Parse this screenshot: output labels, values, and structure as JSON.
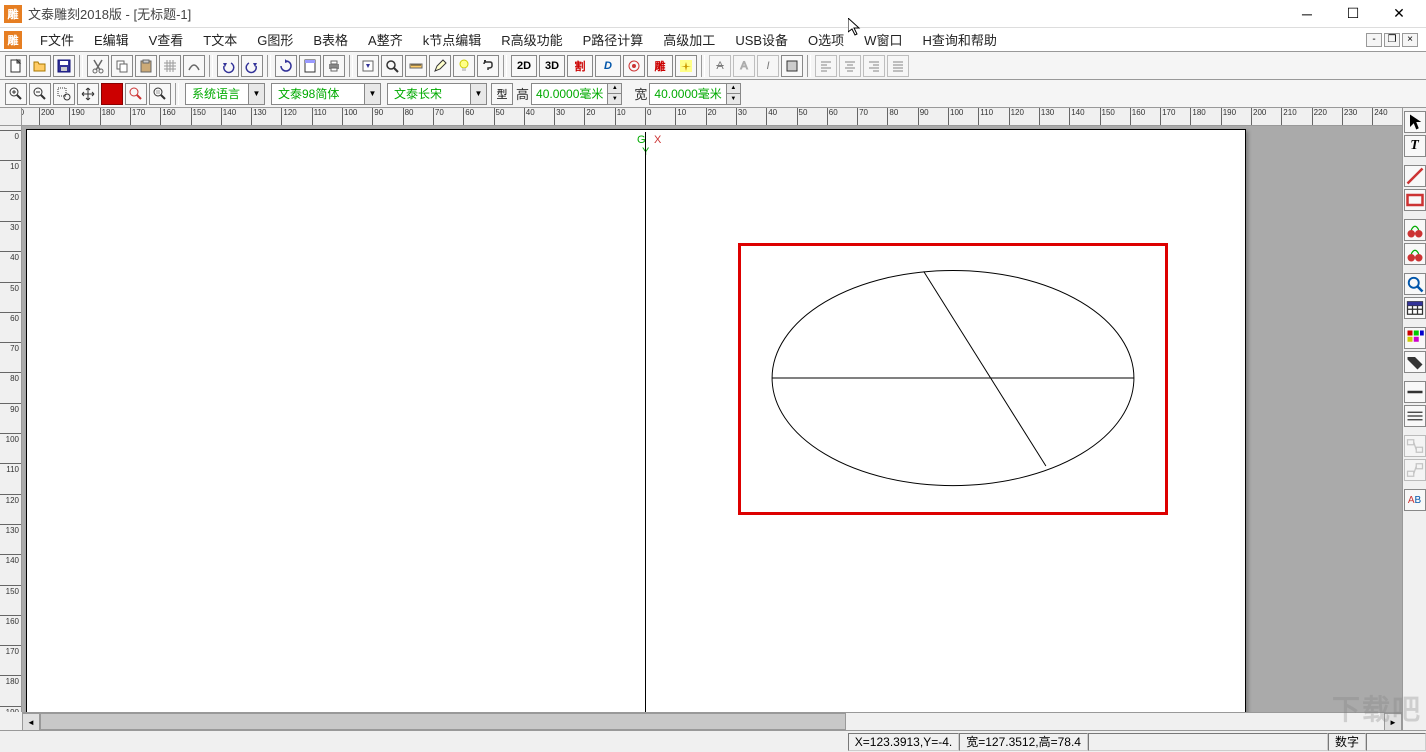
{
  "app_title": "文泰雕刻2018版 - [无标题-1]",
  "app_icon_text": "雕",
  "menu": {
    "items": [
      "F文件",
      "E编辑",
      "V查看",
      "T文本",
      "G图形",
      "B表格",
      "A整齐",
      "k节点编辑",
      "R高级功能",
      "P路径计算",
      "高级加工",
      "USB设备",
      "O选项",
      "W窗口",
      "H查询和帮助"
    ]
  },
  "toolbar1": {
    "labels_2d": "2D",
    "labels_3d": "3D",
    "labels_ge": "割",
    "labels_d": "D",
    "labels_diao": "雕"
  },
  "toolbar2": {
    "lang": "系统语言",
    "font": "文泰98简体",
    "style": "文泰长宋",
    "xing": "型",
    "height_label": "高",
    "height_value": "40.0000毫米",
    "width_label": "宽",
    "width_value": "40.0000毫米"
  },
  "canvas": {
    "origin_g": "G",
    "origin_x": "X",
    "origin_y": "Y"
  },
  "status": {
    "coords": "X=123.3913,Y=-4.",
    "size": "宽=127.3512,高=78.4",
    "mode": "数字"
  },
  "watermark": "下载吧"
}
